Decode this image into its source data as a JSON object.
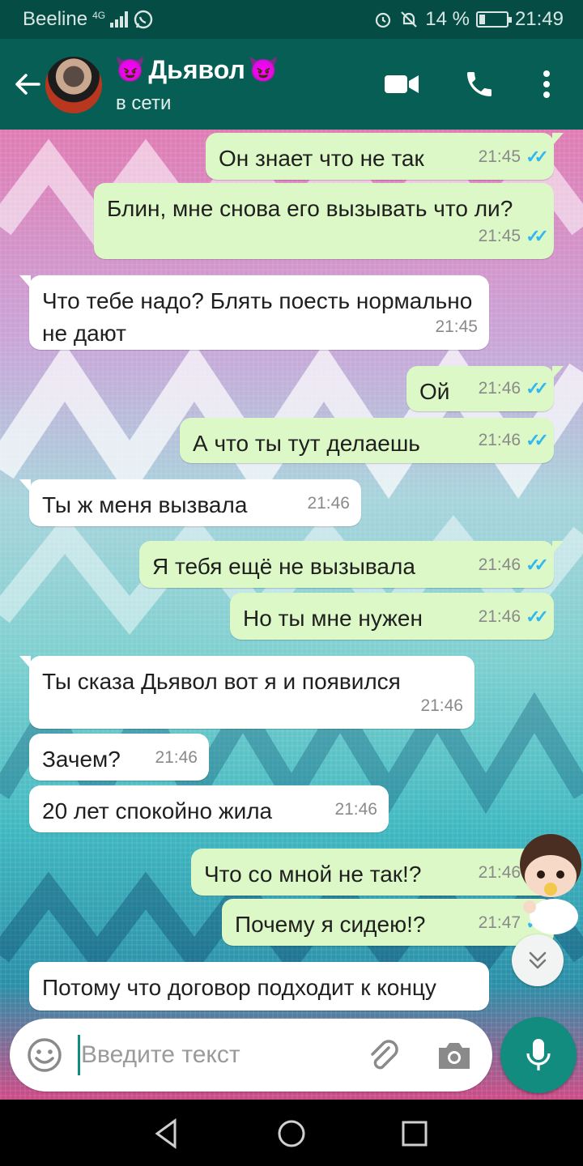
{
  "status_bar": {
    "carrier": "Beeline",
    "network": "4G",
    "battery": "14 %",
    "time": "21:49"
  },
  "header": {
    "title": "Дьявол",
    "status": "в сети"
  },
  "messages": [
    {
      "dir": "out",
      "text": "Он знает что не так",
      "time": "21:45"
    },
    {
      "dir": "out",
      "text": "Блин, мне снова его вызывать что ли?",
      "time": "21:45"
    },
    {
      "dir": "in",
      "text": "Что тебе надо? Блять поесть нормально не дают",
      "time": "21:45"
    },
    {
      "dir": "out",
      "text": "Ой",
      "time": "21:46"
    },
    {
      "dir": "out",
      "text": "А что ты тут делаешь",
      "time": "21:46"
    },
    {
      "dir": "in",
      "text": "Ты ж меня вызвала",
      "time": "21:46"
    },
    {
      "dir": "out",
      "text": "Я тебя ещё не вызывала",
      "time": "21:46"
    },
    {
      "dir": "out",
      "text": "Но ты мне нужен",
      "time": "21:46"
    },
    {
      "dir": "in",
      "text": "Ты сказа Дьявол вот я и появился",
      "time": "21:46"
    },
    {
      "dir": "in",
      "text": "Зачем?",
      "time": "21:46"
    },
    {
      "dir": "in",
      "text": "20 лет спокойно жила",
      "time": "21:46"
    },
    {
      "dir": "out",
      "text": "Что со мной не так!?",
      "time": "21:46"
    },
    {
      "dir": "out",
      "text": "Почему я сидею!?",
      "time": "21:47"
    },
    {
      "dir": "in",
      "text": "Потому что договор подходит к концу",
      "time": ""
    }
  ],
  "composer": {
    "placeholder": "Введите текст"
  },
  "colors": {
    "header": "#075e54",
    "status_bar": "#054d44",
    "outgoing_bubble": "#dcf8c6",
    "incoming_bubble": "#ffffff",
    "read_ticks": "#34b7f1",
    "accent": "#128c7e"
  }
}
